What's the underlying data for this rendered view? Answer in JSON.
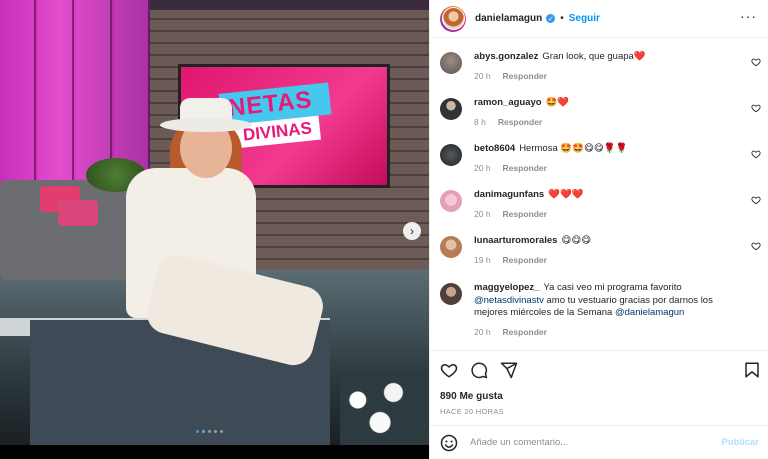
{
  "post": {
    "author": {
      "username": "danielamagun",
      "verified": true,
      "follow_label": "Seguir",
      "separator": "•",
      "more_label": "···"
    },
    "carousel": {
      "slide_count": 5,
      "active_index": 0,
      "next_arrow": "›",
      "image_text_line1": "NETAS",
      "image_text_line2": "DIVINAS"
    },
    "comments": [
      {
        "username": "abys.gonzalez",
        "text": "Gran look, que guapa❤️",
        "time": "20 h",
        "reply_label": "Responder",
        "avatar_color": "#8a7f7a"
      },
      {
        "username": "ramon_aguayo",
        "text": "🤩❤️",
        "time": "8 h",
        "reply_label": "Responder",
        "avatar_color": "#3a3f46"
      },
      {
        "username": "beto8604",
        "text": "Hermosa 🤩🤩😋😋🌹🌹",
        "time": "20 h",
        "reply_label": "Responder",
        "avatar_color": "#2c2f33"
      },
      {
        "username": "danimagunfans",
        "text": "❤️❤️❤️",
        "time": "20 h",
        "reply_label": "Responder",
        "avatar_color": "#e7a3b9"
      },
      {
        "username": "lunaarturomorales",
        "text": "😋😋😋",
        "time": "19 h",
        "reply_label": "Responder",
        "avatar_color": "#c58f6d"
      },
      {
        "username": "maggyelopez_",
        "text_before": "Ya casi veo mi programa favorito ",
        "mention1": "@netasdivinastv",
        "text_middle": " amo tu vestuario gracias por darnos los mejores miércoles de la Semana ",
        "mention2": "@danielamagun",
        "time": "20 h",
        "reply_label": "Responder",
        "avatar_color": "#5a4a44"
      }
    ],
    "actions": {
      "like_icon": "heart-icon",
      "comment_icon": "comment-icon",
      "share_icon": "share-icon",
      "save_icon": "bookmark-icon"
    },
    "likes_text": "890 Me gusta",
    "timestamp": "HACE 20 HORAS",
    "add_comment": {
      "placeholder": "Añade un comentario...",
      "publish_label": "Publicar"
    },
    "colors": {
      "link_blue": "#0095f6",
      "publish_disabled": "#b2dffc",
      "muted": "#8e8e8e"
    }
  }
}
